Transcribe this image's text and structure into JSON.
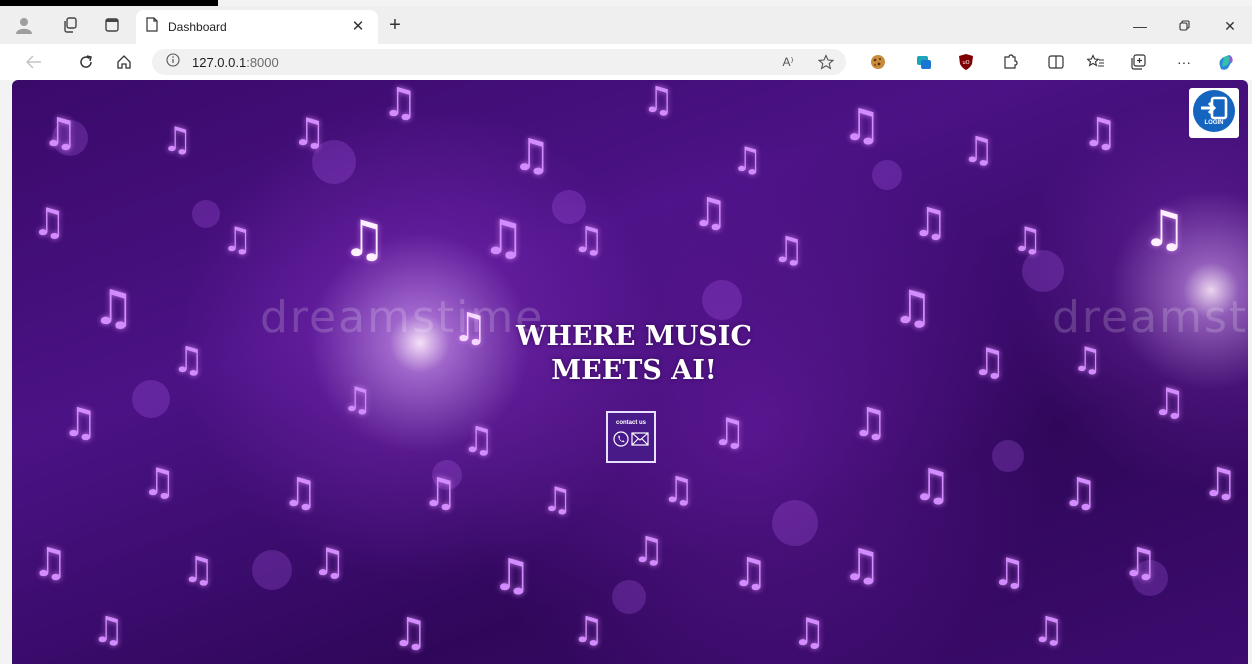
{
  "browser": {
    "tab_title": "Dashboard",
    "address_host": "127.0.0.1",
    "address_port": ":8000",
    "read_aloud_label": "A⁾",
    "more_label": "···"
  },
  "page": {
    "headline_line1": "WHERE MUSIC",
    "headline_line2": "MEETS AI!",
    "contact_label": "contact us",
    "login_label": "LOGIN",
    "watermark_text": "dreamstime"
  },
  "colors": {
    "background_primary": "#3a0a6a",
    "accent_purple": "#d38cff",
    "login_blue": "#1565c0"
  },
  "icons": [
    "profile-icon",
    "workspaces-icon",
    "tab-actions-icon",
    "page-icon",
    "close-icon",
    "new-tab-icon",
    "minimize-icon",
    "restore-icon",
    "back-icon",
    "refresh-icon",
    "home-icon",
    "info-icon",
    "read-aloud-icon",
    "favorite-icon",
    "extension-icon",
    "split-screen-icon",
    "favorites-icon",
    "collections-icon",
    "more-icon",
    "copilot-icon",
    "phone-icon",
    "mail-icon",
    "login-icon"
  ]
}
